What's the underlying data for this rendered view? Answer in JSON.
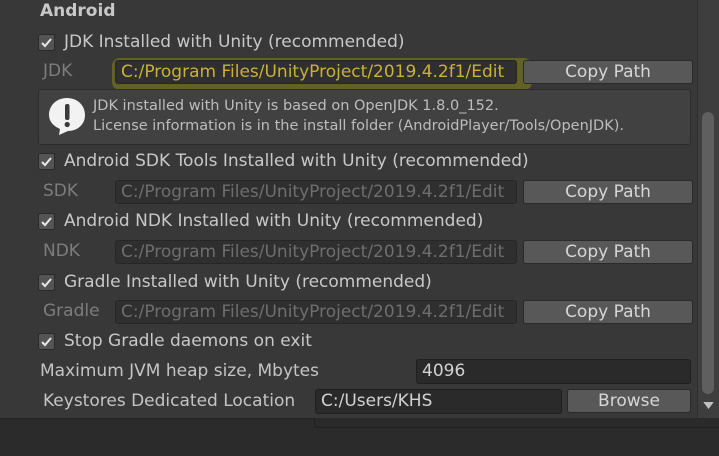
{
  "section": {
    "title": "Android"
  },
  "jdk": {
    "checkbox_label": "JDK Installed with Unity (recommended)",
    "checked": true,
    "path_label": "JDK",
    "path_value": "C:/Program Files/UnityProject/2019.4.2f1/Edit",
    "copy_label": "Copy Path",
    "info_line1": "JDK installed with Unity is based on OpenJDK 1.8.0_152.",
    "info_line2": "License information is in the install folder (AndroidPlayer/Tools/OpenJDK)."
  },
  "sdk": {
    "checkbox_label": "Android SDK Tools Installed with Unity (recommended)",
    "checked": true,
    "path_label": "SDK",
    "path_value": "C:/Program Files/UnityProject/2019.4.2f1/Edit",
    "copy_label": "Copy Path"
  },
  "ndk": {
    "checkbox_label": "Android NDK Installed with Unity (recommended)",
    "checked": true,
    "path_label": "NDK",
    "path_value": "C:/Program Files/UnityProject/2019.4.2f1/Edit",
    "copy_label": "Copy Path"
  },
  "gradle": {
    "checkbox_label": "Gradle Installed with Unity (recommended)",
    "checked": true,
    "path_label": "Gradle",
    "path_value": "C:/Program Files/UnityProject/2019.4.2f1/Edit",
    "copy_label": "Copy Path"
  },
  "stop_gradle": {
    "checkbox_label": "Stop Gradle daemons on exit",
    "checked": true
  },
  "jvm_heap": {
    "label": "Maximum JVM heap size, Mbytes",
    "value": "4096"
  },
  "keystores": {
    "label": "Keystores Dedicated Location",
    "value": "C:/Users/KHS",
    "browse_label": "Browse"
  },
  "icons": {
    "check": "checkmark-icon",
    "info": "exclamation-speech-bubble-icon",
    "scroll_down": "triangle-down-icon"
  },
  "colors": {
    "background": "#383838",
    "highlight": "#6b6a22",
    "button": "#585858"
  }
}
